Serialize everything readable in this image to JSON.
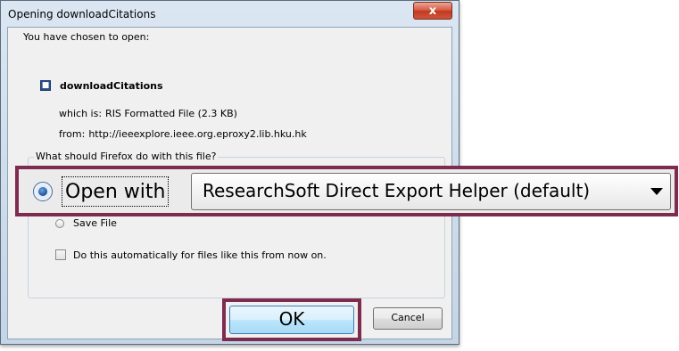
{
  "window": {
    "title": "Opening downloadCitations",
    "close_symbol": "x"
  },
  "dialog": {
    "chosen_text": "You have chosen to open:",
    "file_name": "downloadCitations",
    "file_icon": "ris-file-icon",
    "which_is_label": "which is:",
    "which_is_value": "RIS Formatted File (2.3 KB)",
    "from_label": "from:",
    "from_value": "http://ieeexplore.ieee.org.eproxy2.lib.hku.hk",
    "group_legend": "What should Firefox do with this file?",
    "open_with_label": "Open with",
    "open_with_app": "ResearchSoft Direct Export Helper (default)",
    "open_with_selected": true,
    "save_file_label": "Save File",
    "auto_checkbox_label": "Do this automatically for files like this from now on.",
    "auto_checked": false,
    "ok_label": "OK",
    "cancel_label": "Cancel"
  },
  "colors": {
    "highlight_border": "#7d2b4e",
    "close_button": "#c0391f"
  }
}
